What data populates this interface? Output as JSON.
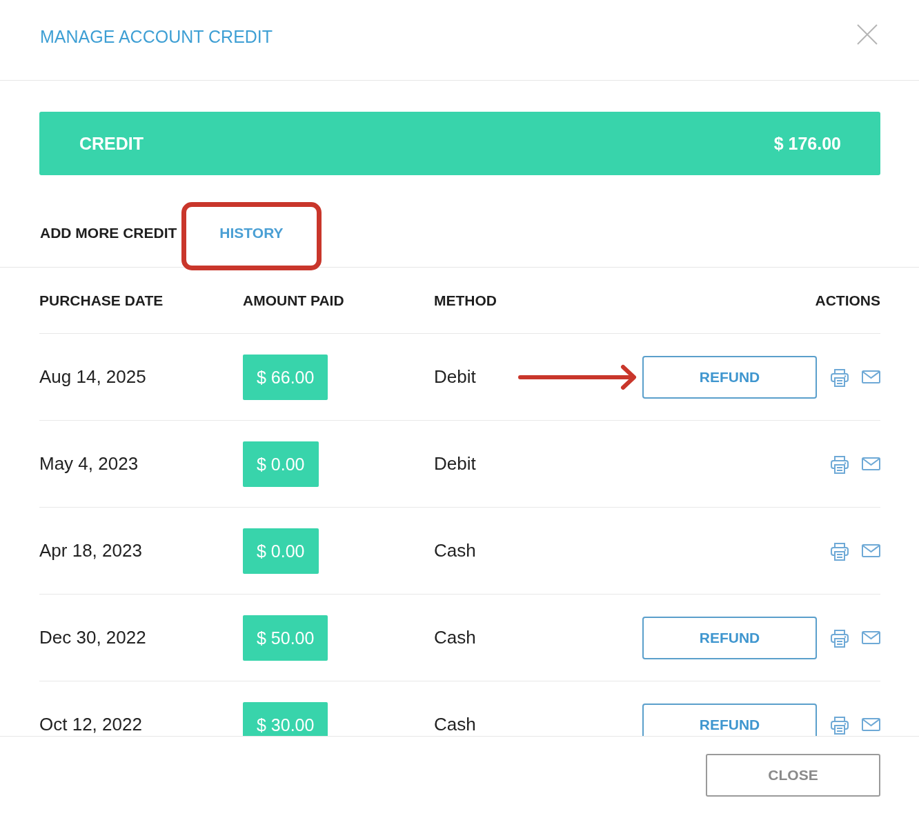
{
  "modal": {
    "title": "MANAGE ACCOUNT CREDIT"
  },
  "credit": {
    "label": "CREDIT",
    "amount": "$ 176.00"
  },
  "tabs": [
    {
      "label": "ADD MORE CREDIT",
      "selected": false,
      "circled": false
    },
    {
      "label": "HISTORY",
      "selected": true,
      "circled": true
    }
  ],
  "table": {
    "columns": [
      "PURCHASE DATE",
      "AMOUNT PAID",
      "METHOD",
      "ACTIONS"
    ],
    "rows": [
      {
        "date": "Aug 14, 2025",
        "amount": "$ 66.00",
        "method": "Debit",
        "refund": "REFUND",
        "arrow": true
      },
      {
        "date": "May 4, 2023",
        "amount": "$ 0.00",
        "method": "Debit",
        "arrow": false
      },
      {
        "date": "Apr 18, 2023",
        "amount": "$ 0.00",
        "method": "Cash",
        "arrow": false
      },
      {
        "date": "Dec 30, 2022",
        "amount": "$ 50.00",
        "method": "Cash",
        "refund": "REFUND",
        "arrow": false
      },
      {
        "date": "Oct 12, 2022",
        "amount": "$ 30.00",
        "method": "Cash",
        "refund": "REFUND",
        "arrow": false
      }
    ]
  },
  "footer": {
    "close_button": "CLOSE"
  }
}
